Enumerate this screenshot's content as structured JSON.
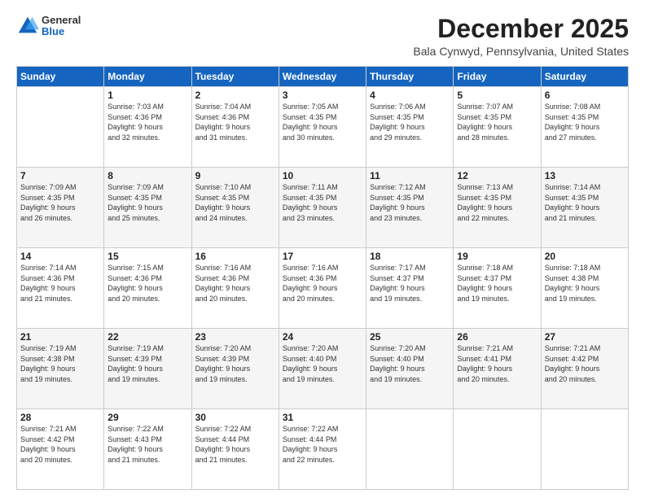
{
  "header": {
    "logo_general": "General",
    "logo_blue": "Blue",
    "main_title": "December 2025",
    "subtitle": "Bala Cynwyd, Pennsylvania, United States"
  },
  "calendar": {
    "days_of_week": [
      "Sunday",
      "Monday",
      "Tuesday",
      "Wednesday",
      "Thursday",
      "Friday",
      "Saturday"
    ],
    "weeks": [
      [
        {
          "day": "",
          "info": ""
        },
        {
          "day": "1",
          "info": "Sunrise: 7:03 AM\nSunset: 4:36 PM\nDaylight: 9 hours\nand 32 minutes."
        },
        {
          "day": "2",
          "info": "Sunrise: 7:04 AM\nSunset: 4:36 PM\nDaylight: 9 hours\nand 31 minutes."
        },
        {
          "day": "3",
          "info": "Sunrise: 7:05 AM\nSunset: 4:35 PM\nDaylight: 9 hours\nand 30 minutes."
        },
        {
          "day": "4",
          "info": "Sunrise: 7:06 AM\nSunset: 4:35 PM\nDaylight: 9 hours\nand 29 minutes."
        },
        {
          "day": "5",
          "info": "Sunrise: 7:07 AM\nSunset: 4:35 PM\nDaylight: 9 hours\nand 28 minutes."
        },
        {
          "day": "6",
          "info": "Sunrise: 7:08 AM\nSunset: 4:35 PM\nDaylight: 9 hours\nand 27 minutes."
        }
      ],
      [
        {
          "day": "7",
          "info": "Sunrise: 7:09 AM\nSunset: 4:35 PM\nDaylight: 9 hours\nand 26 minutes."
        },
        {
          "day": "8",
          "info": "Sunrise: 7:09 AM\nSunset: 4:35 PM\nDaylight: 9 hours\nand 25 minutes."
        },
        {
          "day": "9",
          "info": "Sunrise: 7:10 AM\nSunset: 4:35 PM\nDaylight: 9 hours\nand 24 minutes."
        },
        {
          "day": "10",
          "info": "Sunrise: 7:11 AM\nSunset: 4:35 PM\nDaylight: 9 hours\nand 23 minutes."
        },
        {
          "day": "11",
          "info": "Sunrise: 7:12 AM\nSunset: 4:35 PM\nDaylight: 9 hours\nand 23 minutes."
        },
        {
          "day": "12",
          "info": "Sunrise: 7:13 AM\nSunset: 4:35 PM\nDaylight: 9 hours\nand 22 minutes."
        },
        {
          "day": "13",
          "info": "Sunrise: 7:14 AM\nSunset: 4:35 PM\nDaylight: 9 hours\nand 21 minutes."
        }
      ],
      [
        {
          "day": "14",
          "info": "Sunrise: 7:14 AM\nSunset: 4:36 PM\nDaylight: 9 hours\nand 21 minutes."
        },
        {
          "day": "15",
          "info": "Sunrise: 7:15 AM\nSunset: 4:36 PM\nDaylight: 9 hours\nand 20 minutes."
        },
        {
          "day": "16",
          "info": "Sunrise: 7:16 AM\nSunset: 4:36 PM\nDaylight: 9 hours\nand 20 minutes."
        },
        {
          "day": "17",
          "info": "Sunrise: 7:16 AM\nSunset: 4:36 PM\nDaylight: 9 hours\nand 20 minutes."
        },
        {
          "day": "18",
          "info": "Sunrise: 7:17 AM\nSunset: 4:37 PM\nDaylight: 9 hours\nand 19 minutes."
        },
        {
          "day": "19",
          "info": "Sunrise: 7:18 AM\nSunset: 4:37 PM\nDaylight: 9 hours\nand 19 minutes."
        },
        {
          "day": "20",
          "info": "Sunrise: 7:18 AM\nSunset: 4:38 PM\nDaylight: 9 hours\nand 19 minutes."
        }
      ],
      [
        {
          "day": "21",
          "info": "Sunrise: 7:19 AM\nSunset: 4:38 PM\nDaylight: 9 hours\nand 19 minutes."
        },
        {
          "day": "22",
          "info": "Sunrise: 7:19 AM\nSunset: 4:39 PM\nDaylight: 9 hours\nand 19 minutes."
        },
        {
          "day": "23",
          "info": "Sunrise: 7:20 AM\nSunset: 4:39 PM\nDaylight: 9 hours\nand 19 minutes."
        },
        {
          "day": "24",
          "info": "Sunrise: 7:20 AM\nSunset: 4:40 PM\nDaylight: 9 hours\nand 19 minutes."
        },
        {
          "day": "25",
          "info": "Sunrise: 7:20 AM\nSunset: 4:40 PM\nDaylight: 9 hours\nand 19 minutes."
        },
        {
          "day": "26",
          "info": "Sunrise: 7:21 AM\nSunset: 4:41 PM\nDaylight: 9 hours\nand 20 minutes."
        },
        {
          "day": "27",
          "info": "Sunrise: 7:21 AM\nSunset: 4:42 PM\nDaylight: 9 hours\nand 20 minutes."
        }
      ],
      [
        {
          "day": "28",
          "info": "Sunrise: 7:21 AM\nSunset: 4:42 PM\nDaylight: 9 hours\nand 20 minutes."
        },
        {
          "day": "29",
          "info": "Sunrise: 7:22 AM\nSunset: 4:43 PM\nDaylight: 9 hours\nand 21 minutes."
        },
        {
          "day": "30",
          "info": "Sunrise: 7:22 AM\nSunset: 4:44 PM\nDaylight: 9 hours\nand 21 minutes."
        },
        {
          "day": "31",
          "info": "Sunrise: 7:22 AM\nSunset: 4:44 PM\nDaylight: 9 hours\nand 22 minutes."
        },
        {
          "day": "",
          "info": ""
        },
        {
          "day": "",
          "info": ""
        },
        {
          "day": "",
          "info": ""
        }
      ]
    ]
  }
}
